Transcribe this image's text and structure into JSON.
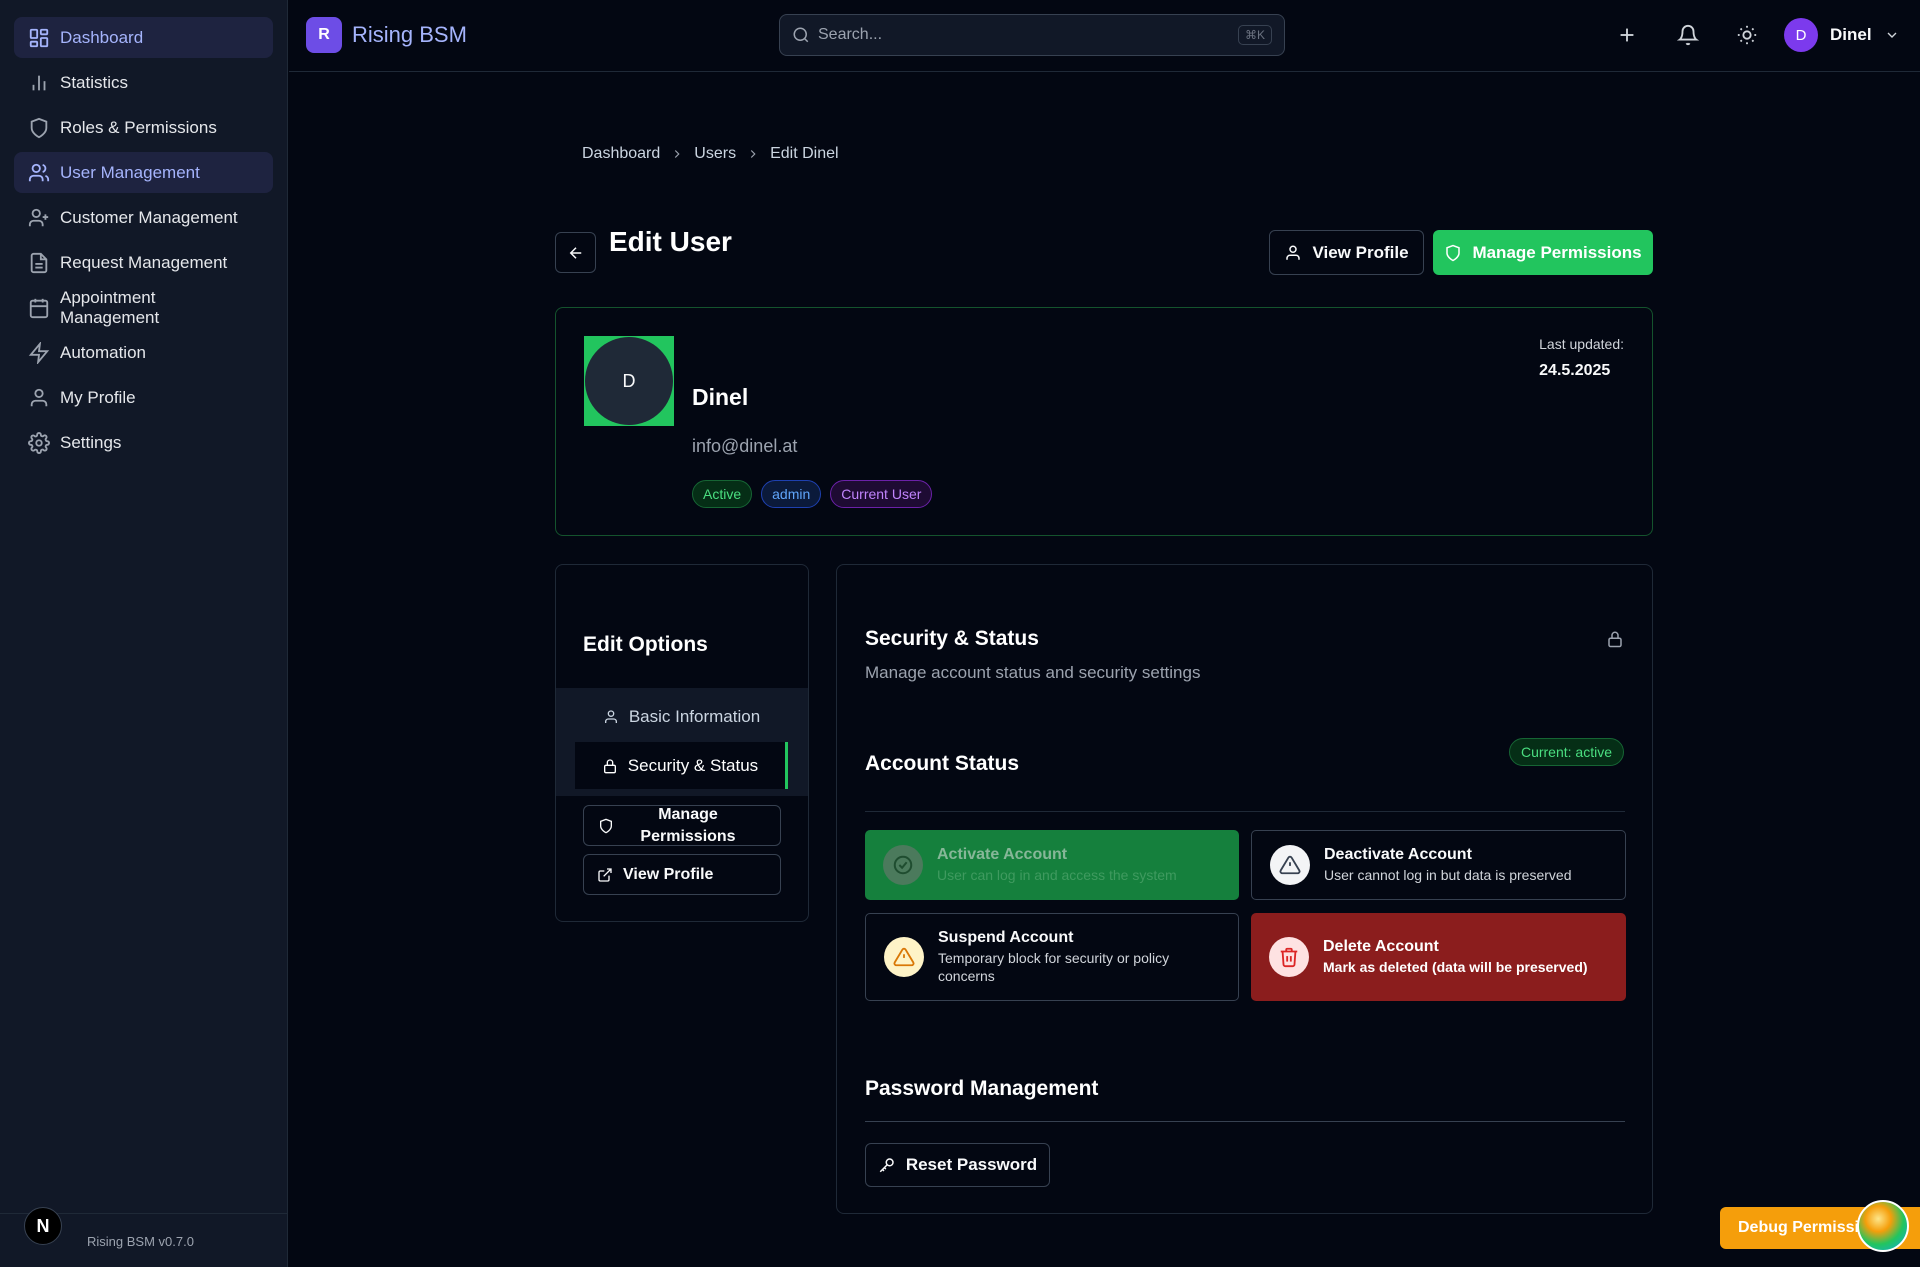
{
  "sidebar": {
    "items": [
      {
        "label": "Dashboard",
        "icon": "layout-dashboard-icon"
      },
      {
        "label": "Statistics",
        "icon": "bar-chart-icon"
      },
      {
        "label": "Roles & Permissions",
        "icon": "shield-icon"
      },
      {
        "label": "User Management",
        "icon": "users-icon"
      },
      {
        "label": "Customer Management",
        "icon": "user-plus-icon"
      },
      {
        "label": "Request Management",
        "icon": "file-text-icon"
      },
      {
        "label": "Appointment Management",
        "icon": "calendar-icon"
      },
      {
        "label": "Automation",
        "icon": "zap-icon"
      },
      {
        "label": "My Profile",
        "icon": "user-icon"
      },
      {
        "label": "Settings",
        "icon": "gear-icon"
      }
    ],
    "version": "Rising BSM v0.7.0",
    "next_badge": "N"
  },
  "header": {
    "logo_letter": "R",
    "app_name": "Rising BSM",
    "search_placeholder": "Search...",
    "search_shortcut": "⌘K",
    "user_initial": "D",
    "user_name": "Dinel"
  },
  "breadcrumb": [
    "Dashboard",
    "Users",
    "Edit Dinel"
  ],
  "page": {
    "title": "Edit User",
    "view_profile_label": "View Profile",
    "manage_permissions_label": "Manage Permissions"
  },
  "profile": {
    "initial": "D",
    "name": "Dinel",
    "email": "info@dinel.at",
    "badges": [
      "Active",
      "admin",
      "Current User"
    ],
    "last_updated_label": "Last updated:",
    "last_updated_value": "24.5.2025"
  },
  "edit_options": {
    "title": "Edit Options",
    "tabs": [
      "Basic Information",
      "Security & Status"
    ],
    "manage_permissions_label": "Manage Permissions",
    "view_profile_label": "View Profile"
  },
  "security": {
    "title": "Security & Status",
    "description": "Manage account status and security settings",
    "account_status_title": "Account Status",
    "current_status": "Current: active",
    "actions": [
      {
        "title": "Activate Account",
        "desc": "User can log in and access the system"
      },
      {
        "title": "Deactivate Account",
        "desc": "User cannot log in but data is preserved"
      },
      {
        "title": "Suspend Account",
        "desc": "Temporary block for security or policy concerns"
      },
      {
        "title": "Delete Account",
        "desc": "Mark as deleted (data will be preserved)"
      }
    ],
    "password_title": "Password Management",
    "reset_password_label": "Reset Password"
  },
  "debug": {
    "label": "Debug Permissions"
  },
  "colors": {
    "background": "#030712",
    "sidebar": "#111827",
    "accent": "#6d4de6",
    "green": "#22c55e",
    "danger": "#991b1b"
  }
}
